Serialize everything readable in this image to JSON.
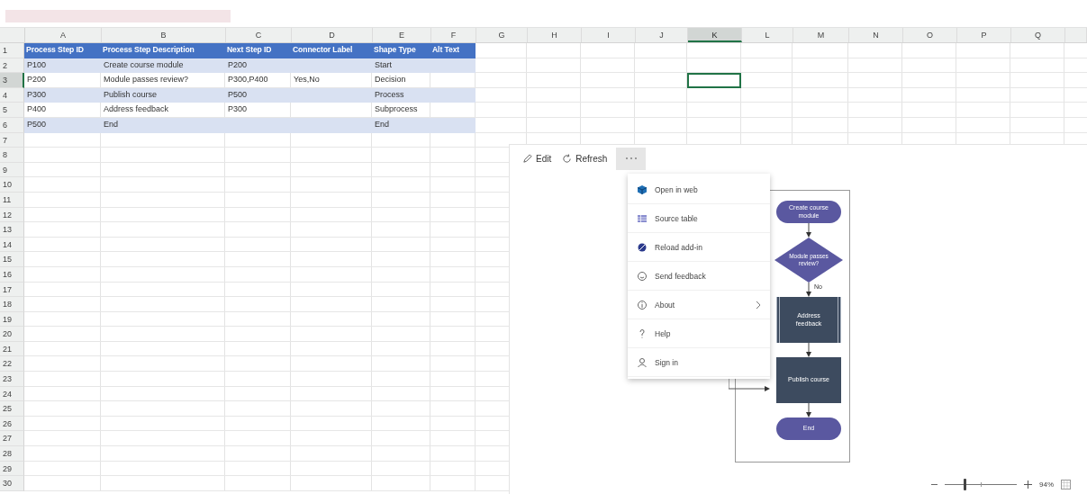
{
  "sheet": {
    "columns": [
      {
        "label": "A",
        "selected": false
      },
      {
        "label": "B",
        "selected": false
      },
      {
        "label": "C",
        "selected": false
      },
      {
        "label": "D",
        "selected": false
      },
      {
        "label": "E",
        "selected": false
      },
      {
        "label": "F",
        "selected": false
      },
      {
        "label": "G",
        "selected": false
      },
      {
        "label": "H",
        "selected": false
      },
      {
        "label": "I",
        "selected": false
      },
      {
        "label": "J",
        "selected": false
      },
      {
        "label": "K",
        "selected": true
      },
      {
        "label": "L",
        "selected": false
      },
      {
        "label": "M",
        "selected": false
      },
      {
        "label": "N",
        "selected": false
      },
      {
        "label": "O",
        "selected": false
      },
      {
        "label": "P",
        "selected": false
      },
      {
        "label": "Q",
        "selected": false
      }
    ],
    "rows": [
      {
        "label": "1",
        "selected": false
      },
      {
        "label": "2",
        "selected": false
      },
      {
        "label": "3",
        "selected": true
      },
      {
        "label": "4",
        "selected": false
      },
      {
        "label": "5",
        "selected": false
      },
      {
        "label": "6",
        "selected": false
      },
      {
        "label": "7",
        "selected": false
      },
      {
        "label": "8",
        "selected": false
      },
      {
        "label": "9",
        "selected": false
      },
      {
        "label": "10",
        "selected": false
      },
      {
        "label": "11",
        "selected": false
      },
      {
        "label": "12",
        "selected": false
      },
      {
        "label": "13",
        "selected": false
      },
      {
        "label": "14",
        "selected": false
      },
      {
        "label": "15",
        "selected": false
      },
      {
        "label": "16",
        "selected": false
      },
      {
        "label": "17",
        "selected": false
      },
      {
        "label": "18",
        "selected": false
      },
      {
        "label": "19",
        "selected": false
      },
      {
        "label": "20",
        "selected": false
      },
      {
        "label": "21",
        "selected": false
      },
      {
        "label": "22",
        "selected": false
      },
      {
        "label": "23",
        "selected": false
      },
      {
        "label": "24",
        "selected": false
      },
      {
        "label": "25",
        "selected": false
      },
      {
        "label": "26",
        "selected": false
      },
      {
        "label": "27",
        "selected": false
      },
      {
        "label": "28",
        "selected": false
      },
      {
        "label": "29",
        "selected": false
      },
      {
        "label": "30",
        "selected": false
      }
    ],
    "table": {
      "header": [
        "Process Step ID",
        "Process Step Description",
        "Next Step ID",
        "Connector Label",
        "Shape Type",
        "Alt Text"
      ],
      "rows": [
        {
          "step_id": "P100",
          "description": "Create course module",
          "next_step_id": "P200",
          "shape_type": "Start"
        },
        {
          "step_id": "P200",
          "description": "Module passes review?",
          "next_step_id": "P300,P400",
          "connector_label": "Yes,No",
          "shape_type": "Decision"
        },
        {
          "step_id": "P300",
          "description": "Publish course",
          "next_step_id": "P500",
          "shape_type": "Process"
        },
        {
          "step_id": "P400",
          "description": "Address feedback",
          "next_step_id": "P300",
          "shape_type": "Subprocess"
        },
        {
          "step_id": "P500",
          "description": "End",
          "shape_type": "End"
        }
      ]
    }
  },
  "addin": {
    "toolbar": [
      {
        "label": "Edit"
      },
      {
        "label": "Refresh"
      }
    ],
    "more_expanded": true,
    "menu": [
      {
        "label": "Open in web",
        "submenu": false
      },
      {
        "label": "Source table",
        "submenu": false
      },
      {
        "label": "Reload add-in",
        "submenu": false
      },
      {
        "label": "Send feedback",
        "submenu": false
      },
      {
        "label": "About",
        "submenu": true
      },
      {
        "label": "Help",
        "submenu": false
      },
      {
        "label": "Sign in",
        "submenu": false
      }
    ],
    "diagram": [
      {
        "kind": "start",
        "label": "Create course module"
      },
      {
        "kind": "decision",
        "label": "Module passes review?",
        "exit_label": "No"
      },
      {
        "kind": "subprocess",
        "label": "Address feedback"
      },
      {
        "kind": "process",
        "label": "Publish course"
      },
      {
        "kind": "end",
        "label": "End"
      }
    ],
    "zoom": {
      "level": 0.28,
      "reading": "94%"
    }
  }
}
